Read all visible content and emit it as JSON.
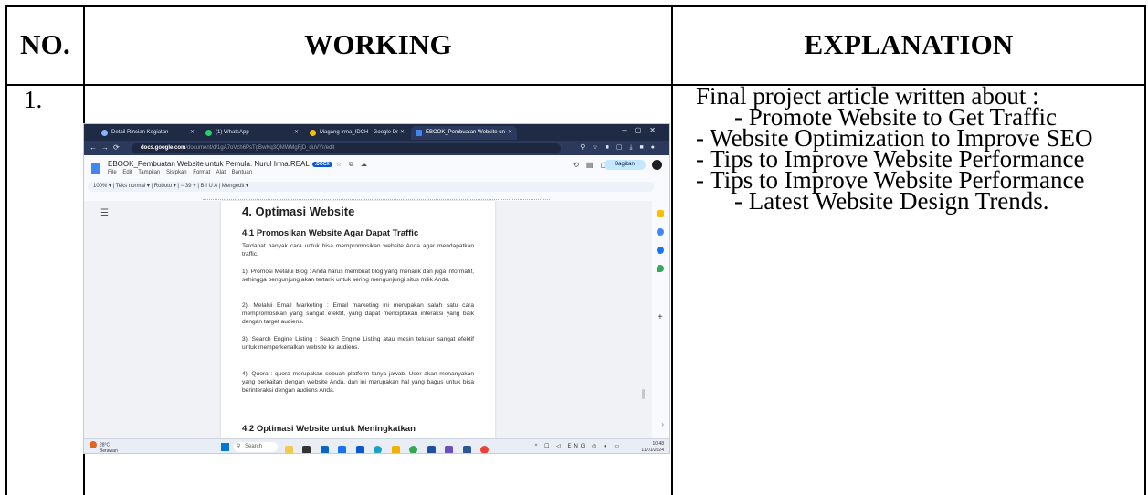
{
  "table": {
    "headers": {
      "no": "NO.",
      "working": "WORKING",
      "explanation": "EXPLANATION"
    },
    "row": {
      "no": "1.",
      "explanation": {
        "intro": "Final project article written about :",
        "items": [
          "- Promote Website to Get Traffic",
          "- Website Optimization to Improve SEO",
          "- Tips to Improve Website Performance",
          "- Tips to Improve Website Performance",
          "- Latest Website Design Trends."
        ]
      }
    }
  },
  "screenshot": {
    "tabs": [
      {
        "label": "Detail Rincian Kegiatan",
        "color": "#8ab4f8"
      },
      {
        "label": "(1) WhatsApp",
        "color": "#25d366"
      },
      {
        "label": "Magang Irma_IDCH - Google Dr",
        "color": "#fbbc04"
      },
      {
        "label": "EBOOK_Pembuatan Website un",
        "color": "#4285f4"
      }
    ],
    "url_host": "docs.google.com",
    "url_path": "/document/d/1gA7oVch6PsTgBwKq3QMWMgFjD_duVYr/edit",
    "doc_title": "EBOOK_Pembuatan Website untuk Pemula. Nurul Irma.REAL",
    "docx_badge": ".DOCX",
    "menus": [
      "File",
      "Edit",
      "Tampilan",
      "Sisipkan",
      "Format",
      "Alat",
      "Bantuan"
    ],
    "share_label": "Bagikan",
    "toolbar_text": "100%  ▾  |  Teks normal  ▾  |  Roboto  ▾  |  −  39  +  |  B   I   U   A   |  Mengedit  ▾",
    "page": {
      "h1": "4. Optimasi Website",
      "h2": "4.1 Promosikan Website Agar Dapat Traffic",
      "paragraphs": [
        "Terdapat banyak cara untuk bisa mempromosikan website Anda agar mendapatkan traffic.",
        "1). Promosi Melalui Blog : Anda harus membuat blog yang menarik dan juga informatif, sehingga pengunjung akan tertarik untuk sering mengunjungi situs milik Anda.",
        "2). Melalui Email Marketing : Email marketing ini merupakan salah satu cara mempromosikan yang sangat efektif, yang dapat menciptakan interaksi yang baik dengan target audiens.",
        "3). Search Engine Listing : Search Engine Listing atau mesin telusur sangat efektif untuk memperkenalkan website ke audiens.",
        "4). Quora : quora merupakan sebuah platform tanya jawab. User akan menanyakan yang berkaitan dengan website Anda, dan ini merupakan hal yang bagus untuk bisa berinteraksi dengan audiens Anda."
      ],
      "h2b": "4.2 Optimasi Website untuk Meningkatkan"
    },
    "taskbar": {
      "weather_temp": "28°C",
      "weather_desc": "Berawan",
      "search_label": "Search",
      "lang": "ENG",
      "time": "10:48",
      "date": "11/01/2024"
    }
  }
}
